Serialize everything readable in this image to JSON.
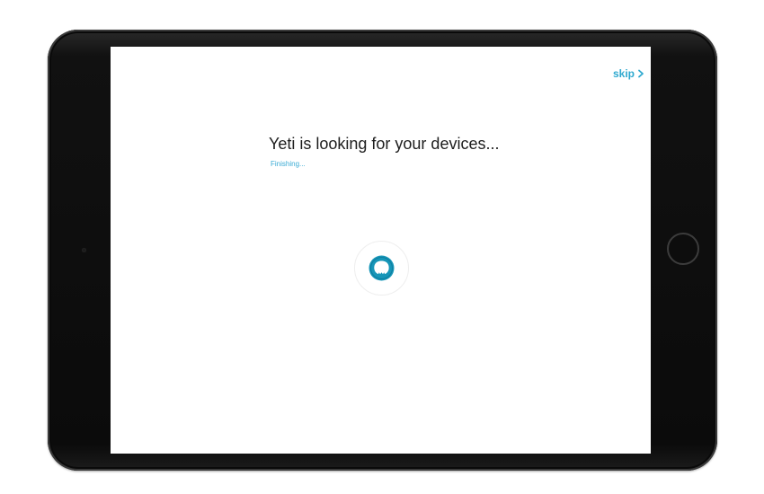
{
  "screen": {
    "skip_label": "skip",
    "heading": "Yeti is looking for your devices...",
    "status": "Finishing..."
  },
  "icons": {
    "skip": "chevron-right-icon",
    "loader": "yeti-loading-spinner-icon",
    "home": "home-button",
    "camera": "front-camera"
  },
  "colors": {
    "accent": "#2fa9cf",
    "spinner": "#1796b8",
    "heading": "#1d1d1d",
    "bezel": "#0b0b0b"
  }
}
